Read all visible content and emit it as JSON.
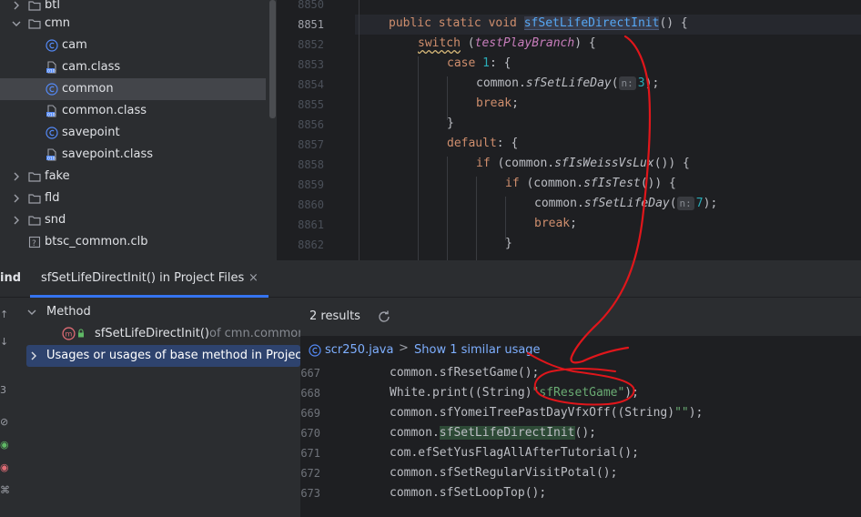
{
  "project_tree": {
    "items": [
      {
        "label": "btl",
        "icon": "folder-icon",
        "expanded": false
      },
      {
        "label": "cmn",
        "icon": "folder-icon",
        "expanded": true
      },
      {
        "label": "cam",
        "icon": "class-icon"
      },
      {
        "label": "cam.class",
        "icon": "class-file-icon"
      },
      {
        "label": "common",
        "icon": "class-icon",
        "selected": true
      },
      {
        "label": "common.class",
        "icon": "class-file-icon"
      },
      {
        "label": "savepoint",
        "icon": "class-icon"
      },
      {
        "label": "savepoint.class",
        "icon": "class-file-icon"
      },
      {
        "label": "fake",
        "icon": "folder-icon",
        "expanded": false
      },
      {
        "label": "fld",
        "icon": "folder-icon",
        "expanded": false
      },
      {
        "label": "snd",
        "icon": "folder-icon",
        "expanded": false
      },
      {
        "label": "btsc_common.clb",
        "icon": "unknown-file-icon"
      }
    ]
  },
  "editor": {
    "line_numbers": [
      "8850",
      "8851",
      "8852",
      "8853",
      "8854",
      "8855",
      "8856",
      "8857",
      "8858",
      "8859",
      "8860",
      "8861",
      "8862"
    ],
    "current_line": "8851",
    "code": {
      "l8851_kw": "public static void ",
      "l8851_fn": "sfSetLifeDirectInit",
      "l8851_rest": "() {",
      "l8852_kw": "switch",
      "l8852_open": " (",
      "l8852_fld": "testPlayBranch",
      "l8852_close": ") {",
      "l8853_kw": "case ",
      "l8853_num": "1",
      "l8853_rest": ": {",
      "l8854_obj": "common.",
      "l8854_fn": "sfSetLifeDay",
      "l8854_open": "(",
      "l8854_hint": "n:",
      "l8854_num": "3",
      "l8854_close": ");",
      "l8855_kw": "break",
      "l8855_rest": ";",
      "l8856": "}",
      "l8857_kw": "default",
      "l8857_rest": ": {",
      "l8858_kw": "if",
      "l8858_a": " (common.",
      "l8858_fn": "sfIsWeissVsLux",
      "l8858_b": "()) {",
      "l8859_kw": "if",
      "l8859_a": " (common.",
      "l8859_fn": "sfIsTest",
      "l8859_b": "()) {",
      "l8860_obj": "common.",
      "l8860_fn": "sfSetLifeDay",
      "l8860_open": "(",
      "l8860_hint": "n:",
      "l8860_num": "7",
      "l8860_close": ");",
      "l8861_kw": "break",
      "l8861_rest": ";",
      "l8862": "}"
    }
  },
  "find_panel": {
    "title": "ind",
    "tab_label": "sfSetLifeDirectInit() in Project Files",
    "tab_close": "×",
    "side_icons": [
      "↑",
      "↓",
      "3",
      "⊘",
      "◉",
      "◉",
      "⌘"
    ],
    "tree": {
      "method_group": "Method",
      "method_name": "sfSetLifeDirectInit()",
      "method_location": "of cmn.common",
      "usages_group": "Usages or usages of base method in Project"
    },
    "results_count": "2 results",
    "file": {
      "name": "scr250.java",
      "separator": ">",
      "similar_link": "Show 1 similar usage"
    },
    "preview_lines": [
      {
        "num": "667",
        "code": "common.sfResetGame();"
      },
      {
        "num": "668",
        "pre": "White.print((String)",
        "str": "\"sfResetGame\"",
        "post": ");"
      },
      {
        "num": "669",
        "pre": "common.sfYomeiTreePastDayVfxOff((String)",
        "str": "\"\"",
        "post": ");"
      },
      {
        "num": "670",
        "pre": "common.",
        "match": "sfSetLifeDirectInit",
        "post": "();"
      },
      {
        "num": "671",
        "code": "com.efSetYusFlagAllAfterTutorial();"
      },
      {
        "num": "672",
        "code": "common.sfSetRegularVisitPotal();"
      },
      {
        "num": "673",
        "code": "common.sfSetLoopTop();"
      }
    ]
  },
  "colors": {
    "annotation": "#e0161b",
    "keyword": "#cf8e6d",
    "function_decl": "#56a8f5",
    "field": "#c77dbb",
    "number": "#2aacb8",
    "string": "#6aab73",
    "link": "#7eafff",
    "selection": "#2e436e"
  }
}
